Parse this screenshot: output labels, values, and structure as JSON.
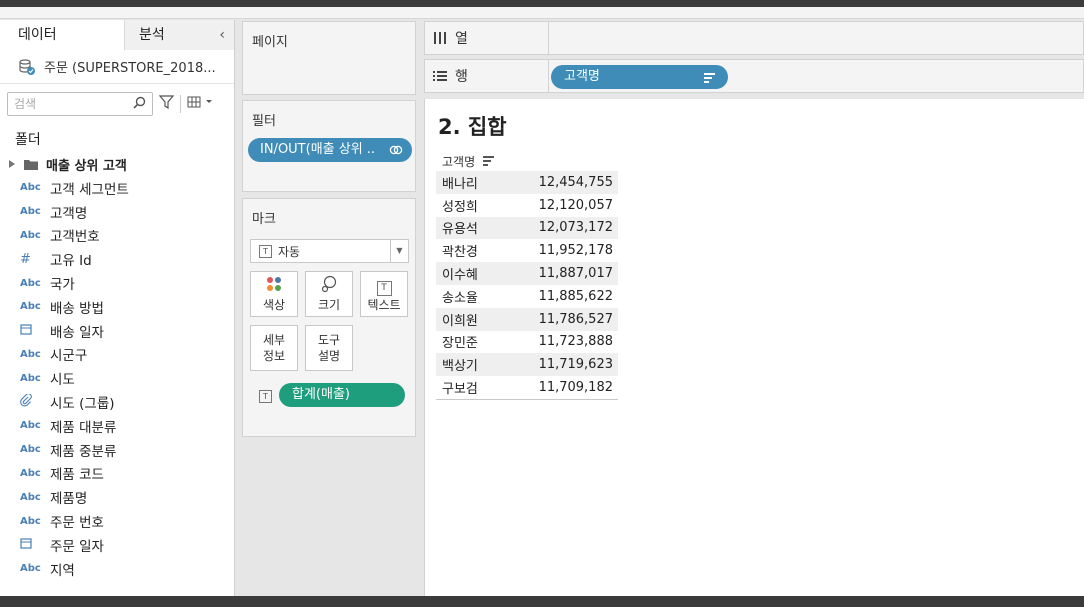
{
  "data_pane": {
    "tab_data": "데이터",
    "tab_analysis": "분석",
    "collapse_glyph": "‹",
    "source_name": "주문 (SUPERSTORE_2018...",
    "search_placeholder": "검색",
    "folders_label": "폴더",
    "folder_name": "매출 상위 고객",
    "fields": [
      {
        "type": "Abc",
        "name": "고객 세그먼트"
      },
      {
        "type": "Abc",
        "name": "고객명"
      },
      {
        "type": "Abc",
        "name": "고객번호"
      },
      {
        "type": "#",
        "name": "고유 Id"
      },
      {
        "type": "Abc",
        "name": "국가"
      },
      {
        "type": "Abc",
        "name": "배송 방법"
      },
      {
        "type": "calendar",
        "name": "배송 일자"
      },
      {
        "type": "Abc",
        "name": "시군구"
      },
      {
        "type": "Abc",
        "name": "시도"
      },
      {
        "type": "paperclip",
        "name": "시도 (그룹)"
      },
      {
        "type": "Abc",
        "name": "제품 대분류"
      },
      {
        "type": "Abc",
        "name": "제품 중분류"
      },
      {
        "type": "Abc",
        "name": "제품 코드"
      },
      {
        "type": "Abc",
        "name": "제품명"
      },
      {
        "type": "Abc",
        "name": "주문 번호"
      },
      {
        "type": "calendar",
        "name": "주문 일자"
      },
      {
        "type": "Abc",
        "name": "지역"
      }
    ]
  },
  "pages_card": {
    "title": "페이지"
  },
  "filters_card": {
    "title": "필터",
    "pill": "IN/OUT(매출 상위 .."
  },
  "marks_card": {
    "title": "마크",
    "mark_type": "자동",
    "buttons": {
      "color": "색상",
      "size": "크기",
      "text": "텍스트",
      "detail": "세부\n정보",
      "tooltip": "도구\n설명"
    },
    "pill": "합계(매출)"
  },
  "columns_shelf": {
    "label": "열"
  },
  "rows_shelf": {
    "label": "행",
    "pill": "고객명"
  },
  "view": {
    "title": "2. 집합",
    "column_header": "고객명",
    "rows": [
      {
        "name": "배나리",
        "value": "12,454,755"
      },
      {
        "name": "성정희",
        "value": "12,120,057"
      },
      {
        "name": "유용석",
        "value": "12,073,172"
      },
      {
        "name": "곽찬경",
        "value": "11,952,178"
      },
      {
        "name": "이수혜",
        "value": "11,887,017"
      },
      {
        "name": "송소율",
        "value": "11,885,622"
      },
      {
        "name": "이희원",
        "value": "11,786,527"
      },
      {
        "name": "장민준",
        "value": "11,723,888"
      },
      {
        "name": "백상기",
        "value": "11,719,623"
      },
      {
        "name": "구보검",
        "value": "11,709,182"
      }
    ]
  },
  "colors": {
    "pill_blue": "#3e8cb7",
    "pill_green": "#1f9e7d",
    "field_icon": "#4a7fb5"
  }
}
